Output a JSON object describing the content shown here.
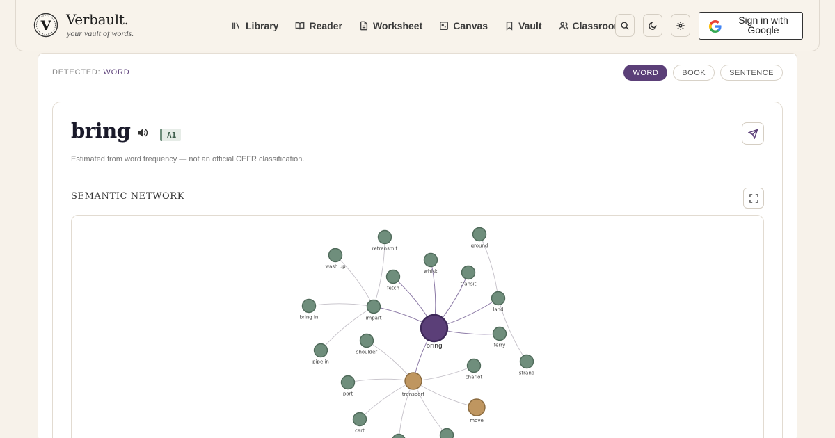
{
  "brand": {
    "name": "Verbault.",
    "tagline": "your vault of words.",
    "logo_letter": "V"
  },
  "nav": [
    {
      "label": "Library",
      "icon": "library-icon"
    },
    {
      "label": "Reader",
      "icon": "book-open-icon"
    },
    {
      "label": "Worksheet",
      "icon": "file-text-icon"
    },
    {
      "label": "Canvas",
      "icon": "canvas-icon"
    },
    {
      "label": "Vault",
      "icon": "bookmark-icon"
    },
    {
      "label": "Classroom",
      "icon": "users-icon"
    }
  ],
  "toolbar_icons": [
    "search-icon",
    "moon-icon",
    "gear-icon"
  ],
  "signin": {
    "label": "Sign in with Google",
    "icon": "google-icon"
  },
  "detected": {
    "prefix": "DETECTED:",
    "value": "WORD"
  },
  "modes": [
    {
      "label": "WORD",
      "active": true
    },
    {
      "label": "BOOK",
      "active": false
    },
    {
      "label": "SENTENCE",
      "active": false
    }
  ],
  "entry": {
    "word": "bring",
    "level": "A1",
    "note": "Estimated from word frequency — not an official CEFR classification."
  },
  "semantic": {
    "title": "SEMANTIC NETWORK"
  },
  "colors": {
    "accent": "#5b3f78",
    "node_default": "#6f8e7c",
    "node_hub": "#bf9660",
    "background": "#f7f2ea"
  },
  "network": {
    "nodes": [
      {
        "id": "bring",
        "label": "bring",
        "kind": "center"
      },
      {
        "id": "impart",
        "label": "impart",
        "kind": "default"
      },
      {
        "id": "transport",
        "label": "transport",
        "kind": "hub"
      },
      {
        "id": "fetch",
        "label": "fetch",
        "kind": "default"
      },
      {
        "id": "whisk",
        "label": "whisk",
        "kind": "default"
      },
      {
        "id": "transit",
        "label": "transit",
        "kind": "default"
      },
      {
        "id": "land",
        "label": "land",
        "kind": "default"
      },
      {
        "id": "ferry",
        "label": "ferry",
        "kind": "default"
      },
      {
        "id": "ground",
        "label": "ground",
        "kind": "default"
      },
      {
        "id": "strand",
        "label": "strand",
        "kind": "default"
      },
      {
        "id": "retransmit",
        "label": "retransmit",
        "kind": "default"
      },
      {
        "id": "wash_up",
        "label": "wash up",
        "kind": "default"
      },
      {
        "id": "bring_in",
        "label": "bring in",
        "kind": "default"
      },
      {
        "id": "pipe_in",
        "label": "pipe in",
        "kind": "default"
      },
      {
        "id": "shoulder",
        "label": "shoulder",
        "kind": "default"
      },
      {
        "id": "chariot",
        "label": "chariot",
        "kind": "default"
      },
      {
        "id": "port",
        "label": "port",
        "kind": "default"
      },
      {
        "id": "move",
        "label": "move",
        "kind": "hub"
      },
      {
        "id": "cart",
        "label": "cart",
        "kind": "default"
      },
      {
        "id": "extra1",
        "label": "",
        "kind": "default"
      },
      {
        "id": "extra2",
        "label": "",
        "kind": "default"
      }
    ],
    "edges": [
      [
        "bring",
        "impart"
      ],
      [
        "bring",
        "transport"
      ],
      [
        "bring",
        "fetch"
      ],
      [
        "bring",
        "whisk"
      ],
      [
        "bring",
        "transit"
      ],
      [
        "bring",
        "land"
      ],
      [
        "bring",
        "ferry"
      ],
      [
        "land",
        "ground"
      ],
      [
        "land",
        "strand"
      ],
      [
        "impart",
        "retransmit"
      ],
      [
        "impart",
        "wash_up"
      ],
      [
        "impart",
        "bring_in"
      ],
      [
        "impart",
        "pipe_in"
      ],
      [
        "transport",
        "shoulder"
      ],
      [
        "transport",
        "chariot"
      ],
      [
        "transport",
        "port"
      ],
      [
        "transport",
        "move"
      ],
      [
        "transport",
        "cart"
      ],
      [
        "transport",
        "extra1"
      ],
      [
        "transport",
        "extra2"
      ]
    ]
  }
}
